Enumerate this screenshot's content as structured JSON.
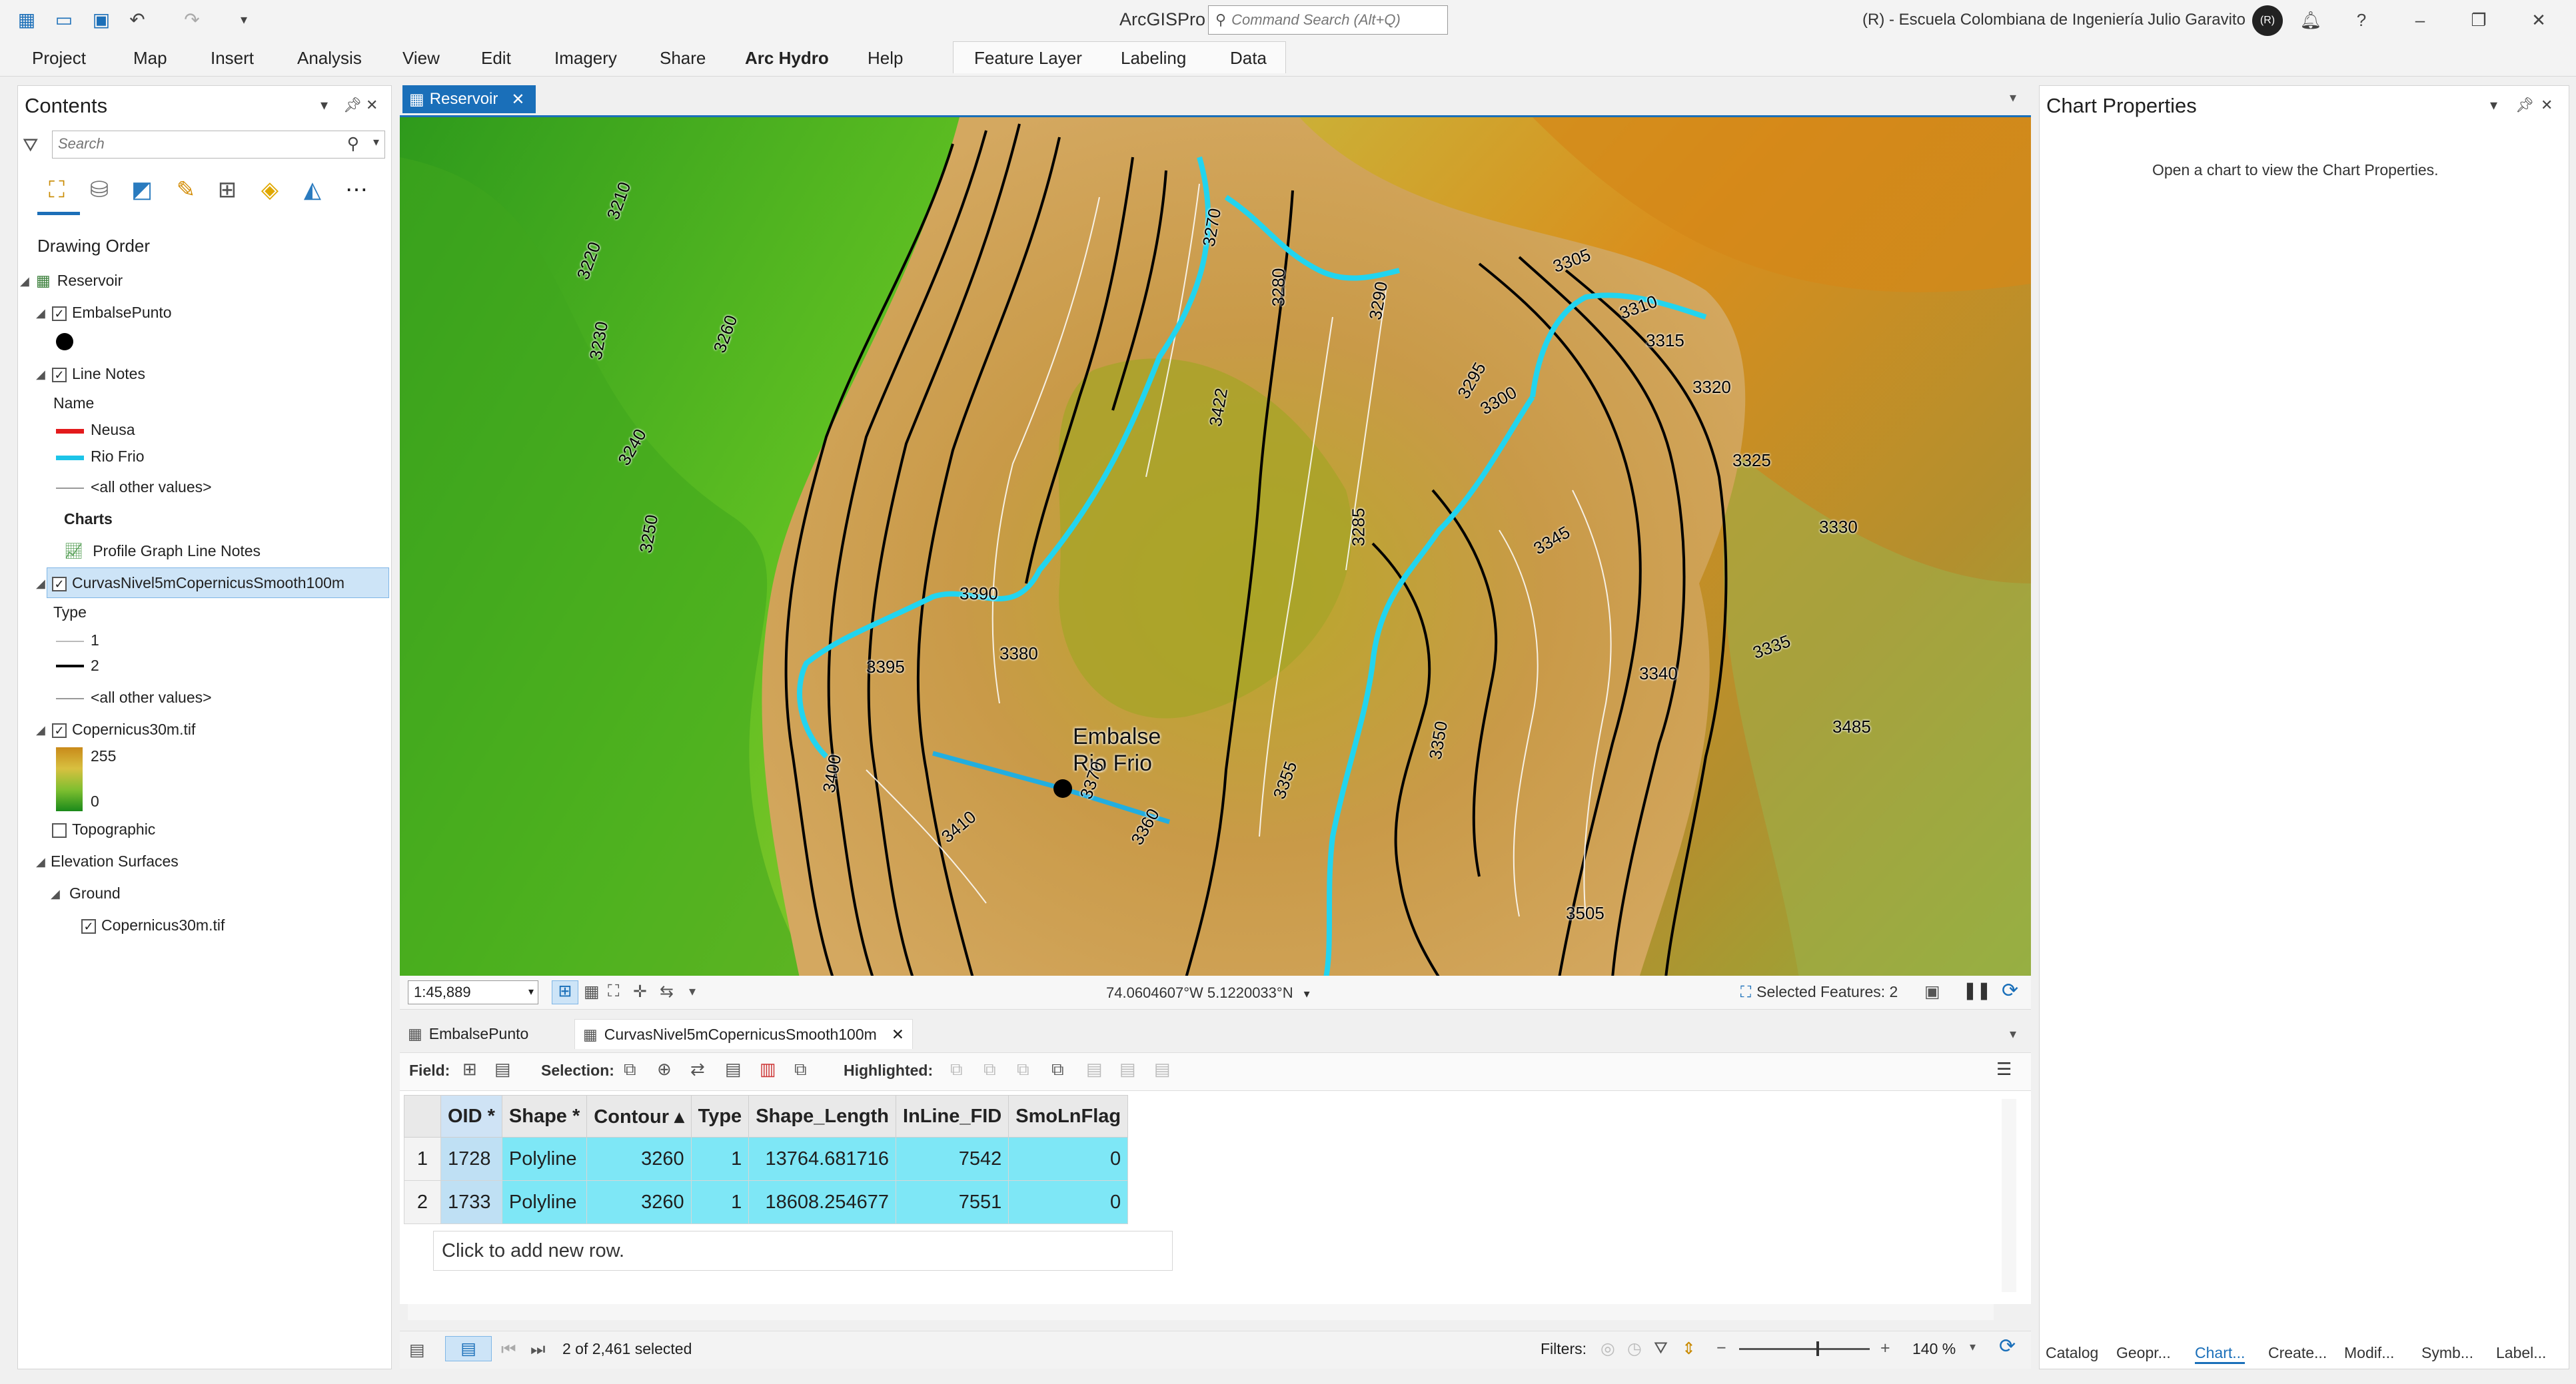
{
  "app": {
    "title": "ArcGISPro",
    "command_search_placeholder": "Command Search (Alt+Q)",
    "license": "(R) - Escuela Colombiana de Ingeniería Julio Garavito",
    "avatar": "(R)",
    "accent": "#1a6fb9"
  },
  "ribbon": {
    "tabs": [
      "Project",
      "Map",
      "Insert",
      "Analysis",
      "View",
      "Edit",
      "Imagery",
      "Share",
      "Arc Hydro",
      "Help"
    ],
    "contextual_tabs": [
      "Feature Layer",
      "Labeling",
      "Data"
    ]
  },
  "contents": {
    "title": "Contents",
    "search_placeholder": "Search",
    "drawing_order": "Drawing Order",
    "map": "Reservoir",
    "layers": {
      "embalse_punto": "EmbalsePunto",
      "line_notes": "Line Notes",
      "name_field": "Name",
      "neusa": "Neusa",
      "rio_frio": "Rio Frio",
      "all_other_1": "<all other values>",
      "charts": "Charts",
      "profile_graph": "Profile Graph Line Notes",
      "curvas": "CurvasNivel5mCopernicusSmooth100m",
      "type_field": "Type",
      "type_1": "1",
      "type_2": "2",
      "all_other_2": "<all other values>",
      "copernicus": "Copernicus30m.tif",
      "ramp_high": "255",
      "ramp_low": "0",
      "topographic": "Topographic",
      "elevation_surfaces": "Elevation Surfaces",
      "ground": "Ground",
      "copernicus_surface": "Copernicus30m.tif"
    },
    "colors": {
      "neusa": "#e31a1c",
      "rio_frio": "#1cc4e8"
    }
  },
  "map": {
    "tab": "Reservoir",
    "scale": "1:45,889",
    "coordinates": "74.0604607°W 5.1220033°N",
    "selected_features": "Selected Features: 2",
    "labels": {
      "embalse": "Embalse",
      "rio_frio": "Rio Frio"
    },
    "contour_labels": [
      "3210",
      "3220",
      "3230",
      "3240",
      "3250",
      "3260",
      "3270",
      "3280",
      "3285",
      "3290",
      "3295",
      "3300",
      "3305",
      "3310",
      "3315",
      "3320",
      "3325",
      "3330",
      "3335",
      "3340",
      "3345",
      "3350",
      "3355",
      "3360",
      "3370",
      "3380",
      "3390",
      "3395",
      "3400",
      "3410",
      "3422",
      "3485",
      "3505"
    ]
  },
  "attribute_table": {
    "tabs": [
      "EmbalsePunto",
      "CurvasNivel5mCopernicusSmooth100m"
    ],
    "toolbar": {
      "field": "Field:",
      "selection": "Selection:",
      "highlighted": "Highlighted:"
    },
    "columns": [
      "OID *",
      "Shape *",
      "Contour",
      "Type",
      "Shape_Length",
      "InLine_FID",
      "SmoLnFlag"
    ],
    "rows": [
      [
        "1",
        "1728",
        "Polyline",
        "3260",
        "1",
        "13764.681716",
        "7542",
        "0"
      ],
      [
        "2",
        "1733",
        "Polyline",
        "3260",
        "1",
        "18608.254677",
        "7551",
        "0"
      ]
    ],
    "add_row": "Click to add new row.",
    "status": "2 of 2,461 selected",
    "filters": "Filters:",
    "zoom": "140 %"
  },
  "chart_properties": {
    "title": "Chart Properties",
    "message": "Open a chart to view the Chart Properties."
  },
  "bottom_tabs": [
    "Catalog",
    "Geopr...",
    "Chart...",
    "Create...",
    "Modif...",
    "Symb...",
    "Label..."
  ]
}
